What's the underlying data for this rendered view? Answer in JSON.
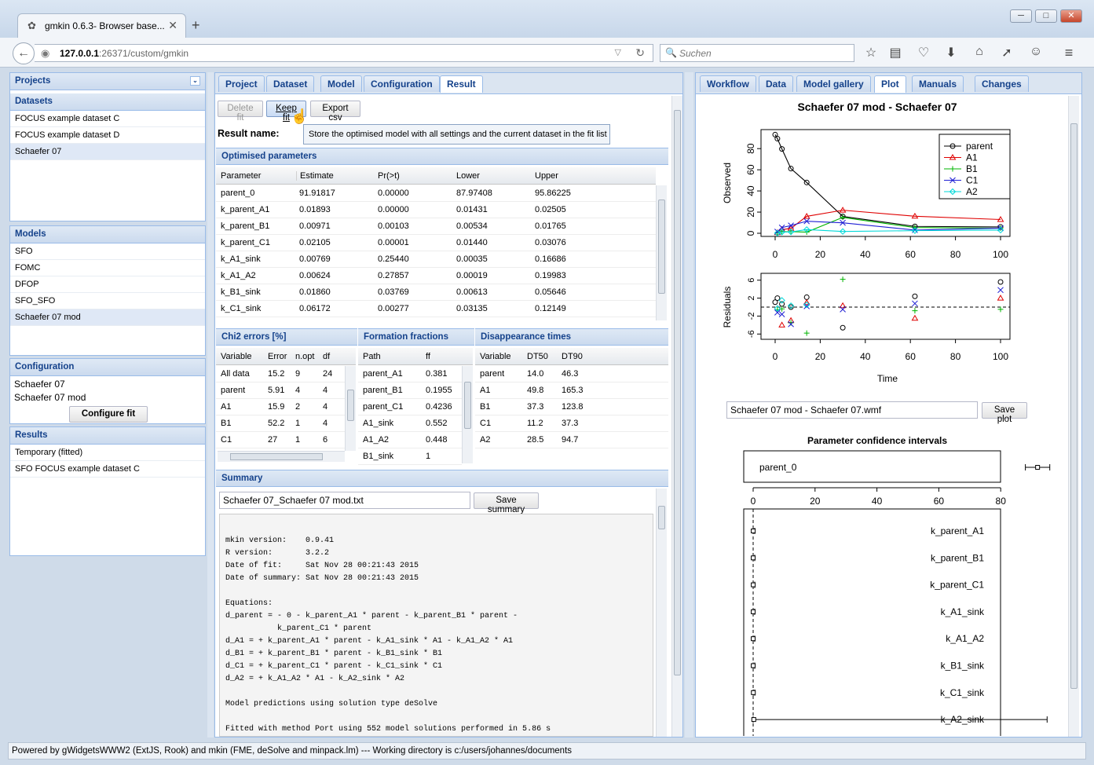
{
  "browser": {
    "tab_title": "gmkin 0.6.3- Browser base...",
    "url_host": "127.0.0.1",
    "url_rest": ":26371/custom/gmkin",
    "search_placeholder": "Suchen"
  },
  "left": {
    "projects_title": "Projects",
    "datasets_title": "Datasets",
    "datasets": [
      "FOCUS example dataset C",
      "FOCUS example dataset D",
      "Schaefer 07"
    ],
    "models_title": "Models",
    "models": [
      "SFO",
      "FOMC",
      "DFOP",
      "SFO_SFO",
      "Schaefer 07 mod"
    ],
    "configuration_title": "Configuration",
    "config_dataset": "Schaefer 07",
    "config_model": "Schaefer 07 mod",
    "configure_fit_label": "Configure fit",
    "results_title": "Results",
    "results": [
      "Temporary (fitted)",
      "SFO FOCUS example dataset C"
    ]
  },
  "middle": {
    "tabs": [
      "Project",
      "Dataset",
      "Model",
      "Configuration",
      "Result"
    ],
    "delete_fit_label": "Delete fit",
    "keep_fit_label": "Keep fit",
    "export_csv_label": "Export csv",
    "result_name_label": "Result name:",
    "tooltip": "Store the optimised model with all settings and the current dataset in the fit list",
    "optimised_title": "Optimised parameters",
    "opt_headers": [
      "Parameter",
      "Estimate",
      "Pr(>t)",
      "Lower",
      "Upper"
    ],
    "opt_rows": [
      [
        "parent_0",
        "91.91817",
        "0.00000",
        "87.97408",
        "95.86225"
      ],
      [
        "k_parent_A1",
        "0.01893",
        "0.00000",
        "0.01431",
        "0.02505"
      ],
      [
        "k_parent_B1",
        "0.00971",
        "0.00103",
        "0.00534",
        "0.01765"
      ],
      [
        "k_parent_C1",
        "0.02105",
        "0.00001",
        "0.01440",
        "0.03076"
      ],
      [
        "k_A1_sink",
        "0.00769",
        "0.25440",
        "0.00035",
        "0.16686"
      ],
      [
        "k_A1_A2",
        "0.00624",
        "0.27857",
        "0.00019",
        "0.19983"
      ],
      [
        "k_B1_sink",
        "0.01860",
        "0.03769",
        "0.00613",
        "0.05646"
      ],
      [
        "k_C1_sink",
        "0.06172",
        "0.00277",
        "0.03135",
        "0.12149"
      ]
    ],
    "chi2_title": "Chi2 errors [%]",
    "chi2_headers": [
      "Variable",
      "Error",
      "n.opt",
      "df"
    ],
    "chi2_rows": [
      [
        "All data",
        "15.2",
        "9",
        "24"
      ],
      [
        "parent",
        "5.91",
        "4",
        "4"
      ],
      [
        "A1",
        "15.9",
        "2",
        "4"
      ],
      [
        "B1",
        "52.2",
        "1",
        "4"
      ],
      [
        "C1",
        "27",
        "1",
        "6"
      ]
    ],
    "ff_title": "Formation fractions",
    "ff_headers": [
      "Path",
      "ff"
    ],
    "ff_rows": [
      [
        "parent_A1",
        "0.381"
      ],
      [
        "parent_B1",
        "0.1955"
      ],
      [
        "parent_C1",
        "0.4236"
      ],
      [
        "A1_sink",
        "0.552"
      ],
      [
        "A1_A2",
        "0.448"
      ],
      [
        "B1_sink",
        "1"
      ]
    ],
    "dt_title": "Disappearance times",
    "dt_headers": [
      "Variable",
      "DT50",
      "DT90"
    ],
    "dt_rows": [
      [
        "parent",
        "14.0",
        "46.3"
      ],
      [
        "A1",
        "49.8",
        "165.3"
      ],
      [
        "B1",
        "37.3",
        "123.8"
      ],
      [
        "C1",
        "11.2",
        "37.3"
      ],
      [
        "A2",
        "28.5",
        "94.7"
      ]
    ],
    "summary_title": "Summary",
    "summary_file": "Schaefer 07_Schaefer 07 mod.txt",
    "save_summary_label": "Save summary",
    "summary_text": "mkin version:    0.9.41\nR version:       3.2.2\nDate of fit:     Sat Nov 28 00:21:43 2015\nDate of summary: Sat Nov 28 00:21:43 2015\n\nEquations:\nd_parent = - 0 - k_parent_A1 * parent - k_parent_B1 * parent -\n           k_parent_C1 * parent\nd_A1 = + k_parent_A1 * parent - k_A1_sink * A1 - k_A1_A2 * A1\nd_B1 = + k_parent_B1 * parent - k_B1_sink * B1\nd_C1 = + k_parent_C1 * parent - k_C1_sink * C1\nd_A2 = + k_A1_A2 * A1 - k_A2_sink * A2\n\nModel predictions using solution type deSolve\n\nFitted with method Port using 552 model solutions performed in 5.86 s"
  },
  "right": {
    "tabs": [
      "Workflow",
      "Data",
      "Model gallery",
      "Plot",
      "Manuals",
      "Changes"
    ],
    "plot_title": "Schaefer 07 mod - Schaefer 07",
    "plot_file": "Schaefer 07 mod - Schaefer 07.wmf",
    "save_plot_label": "Save plot",
    "ci_title": "Parameter confidence intervals"
  },
  "chart_data": [
    {
      "type": "scatter",
      "title": "Schaefer 07 mod - Schaefer 07",
      "xlabel": "",
      "ylabel": "Observed",
      "xlim": [
        0,
        100
      ],
      "ylim": [
        0,
        95
      ],
      "x_ticks": [
        0,
        20,
        40,
        60,
        80,
        100
      ],
      "y_ticks": [
        0,
        20,
        40,
        60,
        80
      ],
      "legend": "top-right",
      "colors": {
        "parent": "#000000",
        "A1": "#df0000",
        "B1": "#00b400",
        "C1": "#1f1fd4",
        "A2": "#00d8d8"
      },
      "series": [
        {
          "name": "parent",
          "x": [
            0,
            1,
            3,
            7,
            14,
            30,
            62,
            100
          ],
          "y": [
            93.2,
            89.4,
            79.7,
            61.1,
            48.0,
            15.9,
            6.5,
            6.0
          ]
        },
        {
          "name": "A1",
          "x": [
            1,
            3,
            7,
            14,
            30,
            62,
            100
          ],
          "y": [
            0.6,
            3.5,
            4.6,
            16.0,
            21.8,
            16.1,
            13.0
          ]
        },
        {
          "name": "B1",
          "x": [
            1,
            3,
            7,
            14,
            30,
            62,
            100
          ],
          "y": [
            0.3,
            1.4,
            1.5,
            1.1,
            15.0,
            5.4,
            4.8
          ]
        },
        {
          "name": "C1",
          "x": [
            1,
            3,
            7,
            14,
            30,
            62,
            100
          ],
          "y": [
            1.5,
            5.4,
            7.3,
            11.4,
            9.9,
            3.0,
            4.8
          ]
        },
        {
          "name": "A2",
          "x": [
            1,
            3,
            7,
            14,
            30,
            62,
            100
          ],
          "y": [
            0.2,
            1.1,
            1.3,
            3.5,
            1.7,
            2.5,
            3.0
          ]
        }
      ]
    },
    {
      "type": "scatter",
      "title": "",
      "xlabel": "Time",
      "ylabel": "Residuals",
      "xlim": [
        0,
        100
      ],
      "ylim": [
        -7,
        7
      ],
      "x_ticks": [
        0,
        20,
        40,
        60,
        80,
        100
      ],
      "y_ticks": [
        -6,
        -2,
        2,
        6
      ],
      "series": [
        {
          "name": "parent",
          "x": [
            0,
            1,
            3,
            7,
            14,
            30,
            62,
            100
          ],
          "y": [
            1.1,
            2.0,
            0.7,
            0.0,
            2.2,
            -4.6,
            2.4,
            5.6
          ]
        },
        {
          "name": "A1",
          "x": [
            3,
            7,
            14,
            30,
            62,
            100
          ],
          "y": [
            -4.0,
            -3.0,
            1.0,
            0.3,
            -2.5,
            2.0
          ]
        },
        {
          "name": "B1",
          "x": [
            1,
            3,
            7,
            14,
            30,
            62,
            100
          ],
          "y": [
            -0.6,
            -0.4,
            -3.5,
            -5.8,
            6.2,
            -0.8,
            -0.5
          ]
        },
        {
          "name": "C1",
          "x": [
            1,
            3,
            7,
            14,
            30,
            62,
            100
          ],
          "y": [
            -1.2,
            -1.6,
            -3.8,
            0.2,
            -0.5,
            0.8,
            3.8
          ]
        },
        {
          "name": "A2",
          "x": [
            1,
            3,
            7,
            14
          ],
          "y": [
            -0.3,
            1.5,
            0.3,
            0.5
          ]
        }
      ]
    },
    {
      "type": "scatter",
      "title": "Parameter confidence intervals",
      "xlim": [
        0,
        100
      ],
      "x_ticks": [
        0,
        20,
        40,
        60,
        80
      ],
      "categories": [
        "parent_0",
        "k_parent_A1",
        "k_parent_B1",
        "k_parent_C1",
        "k_A1_sink",
        "k_A1_A2",
        "k_B1_sink",
        "k_C1_sink",
        "k_A2_sink"
      ],
      "estimate": [
        91.91817,
        0.01893,
        0.00971,
        0.02105,
        0.00769,
        0.00624,
        0.0186,
        0.06172,
        0.2
      ],
      "lower": [
        87.97408,
        0.01431,
        0.00534,
        0.0144,
        0.00035,
        0.00019,
        0.00613,
        0.03135,
        0.0
      ],
      "upper": [
        95.86225,
        0.02505,
        0.01765,
        0.03076,
        0.16686,
        0.19983,
        0.05646,
        0.12149,
        95.0
      ]
    }
  ],
  "status_bar": "Powered by gWidgetsWWW2 (ExtJS, Rook) and mkin (FME, deSolve and minpack.lm) --- Working directory is c:/users/johannes/documents"
}
